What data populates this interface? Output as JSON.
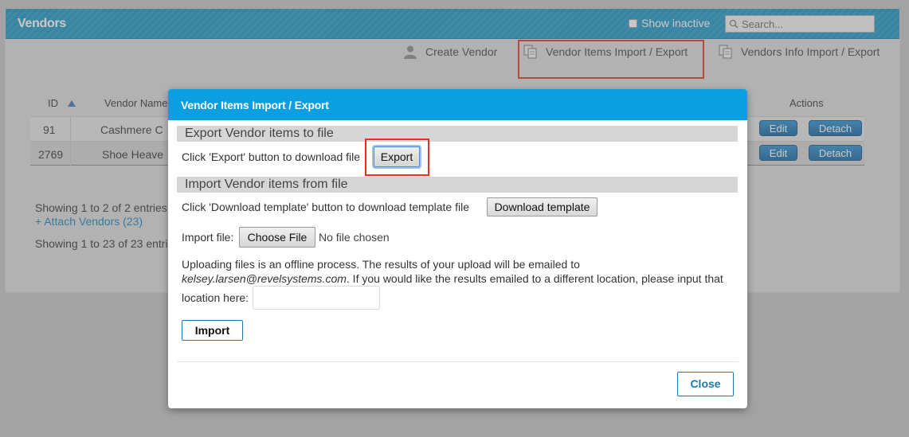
{
  "header": {
    "title": "Vendors",
    "show_inactive_label": "Show inactive",
    "search_placeholder": "Search..."
  },
  "toolbar": {
    "create_vendor": "Create Vendor",
    "vendor_items_import_export": "Vendor Items Import / Export",
    "vendors_info_import_export": "Vendors Info Import / Export"
  },
  "table": {
    "columns": {
      "id": "ID",
      "vendor_name": "Vendor Name",
      "actions": "Actions"
    },
    "rows": [
      {
        "id": "91",
        "vendor_name": "Cashmere C",
        "edit": "Edit",
        "detach": "Detach"
      },
      {
        "id": "2769",
        "vendor_name": "Shoe Heave",
        "edit": "Edit",
        "detach": "Detach"
      }
    ],
    "showing_1": "Showing 1 to 2 of 2 entries",
    "attach_vendors": "+ Attach Vendors (23)",
    "showing_2": "Showing 1 to 23 of 23 entri"
  },
  "modal": {
    "title": "Vendor Items Import / Export",
    "export_section": "Export Vendor items to file",
    "export_instruction": "Click 'Export' button to download file",
    "export_button": "Export",
    "import_section": "Import Vendor items from file",
    "template_instruction": "Click 'Download template' button to download template file",
    "download_template_button": "Download template",
    "import_file_label": "Import file:",
    "choose_file_button": "Choose File",
    "no_file_chosen": "No file chosen",
    "upload_note_line1": "Uploading files is an offline process. The results of your upload will be emailed to",
    "upload_email": "kelsey.larsen@revelsystems.com",
    "upload_note_line2_rest": ". If you would like the results emailed to a different location, please input that",
    "location_label": "location here:",
    "location_value": "",
    "import_button": "Import",
    "close_button": "Close"
  },
  "colors": {
    "header_blue": "#1996c6",
    "modal_header_blue": "#0b9ee0",
    "highlight_red": "#e8301c",
    "action_button_blue": "#1877b8"
  },
  "icons": {
    "create_vendor": "user-icon",
    "vendor_items": "copy-icon",
    "vendors_info": "copy-icon",
    "search": "search-icon",
    "sort": "sort-ascending-icon"
  }
}
